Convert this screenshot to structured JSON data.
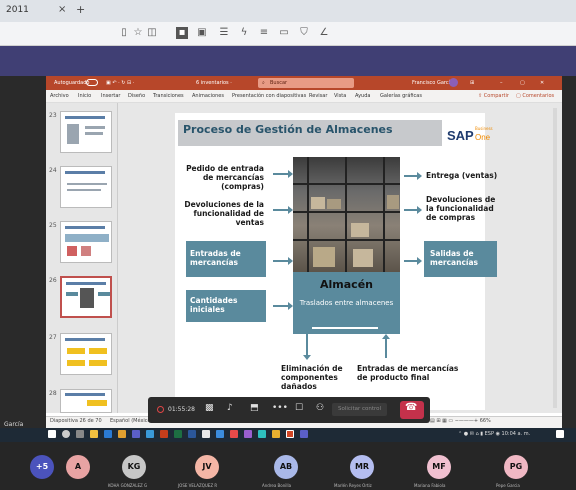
{
  "browser": {
    "tab_title": "2011",
    "tab_close": "×",
    "tab_new": "+"
  },
  "ppt": {
    "autosave_label": "Autoguardado",
    "filename": "6 inventarios ·",
    "search": "Buscar",
    "user": "Francisco García",
    "ribbon": [
      "Archivo",
      "Inicio",
      "Insertar",
      "Diseño",
      "Transiciones",
      "Animaciones",
      "Presentación con diapositivas",
      "Revisar",
      "Vista",
      "Ayuda",
      "Galerías gráficas"
    ],
    "share_label": "Compartir",
    "comments_label": "Comentarios",
    "slide_numbers": [
      "23",
      "24",
      "25",
      "26",
      "27",
      "28"
    ],
    "status_left": "Diapositiva 26 de 70",
    "status_lang": "Español (México)"
  },
  "slide": {
    "title": "Proceso de Gestión de Almacenes",
    "logo_sap": "SAP",
    "logo_business": "Business",
    "logo_one": "One",
    "inputs_text": [
      "Pedido de entrada de mercancías (compras)",
      "Devoluciones de la funcionalidad de ventas"
    ],
    "inputs_box": [
      "Entradas de mercancías",
      "Cantidades iniciales"
    ],
    "outputs_text": [
      "Entrega (ventas)",
      "Devoluciones de la funcionalidad de compras"
    ],
    "outputs_box": [
      "Salidas de mercancías"
    ],
    "center_title": "Almacén",
    "center_sub": "Traslados entre almacenes",
    "bottom_left": "Eliminación de componentes dañados",
    "bottom_right": "Entradas de mercancías de producto final"
  },
  "meeting": {
    "rec_time": "01:55:28",
    "request_control": "Solicitar control",
    "left_label": "García",
    "tray_time": "10:04 a. m.",
    "tray_lang": "ESP",
    "participants": [
      {
        "initials": "+5",
        "color": "#4b53bc",
        "name": ""
      },
      {
        "initials": "A",
        "color": "#e8a3a3",
        "name": ""
      },
      {
        "initials": "KG",
        "color": "#c7c7c7",
        "name": "KOHA GONZALEZ G"
      },
      {
        "initials": "JV",
        "color": "#f4b6a6",
        "name": "JOSE VELAZQUEZ R"
      },
      {
        "initials": "AB",
        "color": "#a9b8e8",
        "name": "Andrea Bonilla"
      },
      {
        "initials": "MR",
        "color": "#b4bdf0",
        "name": "Marlén Reyes Ortiz"
      },
      {
        "initials": "MF",
        "color": "#f0c0d0",
        "name": "Mariana Fabiola"
      },
      {
        "initials": "PG",
        "color": "#f0b8c4",
        "name": "Pepe Garcia"
      }
    ]
  }
}
